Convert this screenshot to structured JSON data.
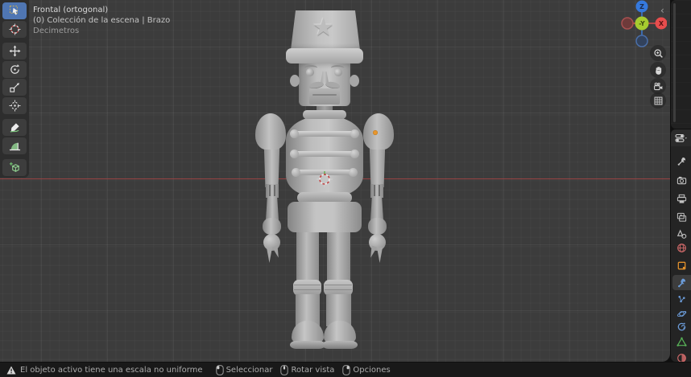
{
  "viewport_overlay": {
    "view_name": "Frontal (ortogonal)",
    "collection_path": "(0) Colección de la escena | Brazo",
    "units": "Decimetros"
  },
  "axis_gizmo": {
    "z_label": "Z",
    "x_label": "X",
    "center_label": "-Y",
    "x_color": "#e84d4d",
    "z_color": "#3579dd",
    "center_color": "#a6cc2f",
    "neg_x_color": "#6e3a3a",
    "neg_z_color": "#32425c"
  },
  "toolbar": {
    "tools": [
      {
        "icon": "select-box-icon",
        "active": true
      },
      {
        "icon": "cursor-icon",
        "active": false
      },
      {
        "icon": "move-icon",
        "active": false
      },
      {
        "icon": "rotate-icon",
        "active": false
      },
      {
        "icon": "scale-icon",
        "active": false
      },
      {
        "icon": "transform-icon",
        "active": false
      },
      {
        "icon": "annotate-icon",
        "active": false
      },
      {
        "icon": "measure-icon",
        "active": false
      },
      {
        "icon": "add-cube-icon",
        "active": false
      }
    ],
    "groups": [
      2,
      4,
      2,
      1
    ]
  },
  "nav_buttons": [
    {
      "icon": "zoom-icon"
    },
    {
      "icon": "pan-hand-icon"
    },
    {
      "icon": "camera-view-icon"
    },
    {
      "icon": "grid-ortho-icon"
    }
  ],
  "sidebar_toggle_glyph": "‹",
  "properties_editor": {
    "header_icon": "properties-editor-icon",
    "active_tab": "modifiers",
    "tabs": [
      {
        "name": "tool",
        "color": "#c2c2c2"
      },
      {
        "name": "render",
        "color": "#c2c2c2"
      },
      {
        "name": "output",
        "color": "#c2c2c2"
      },
      {
        "name": "view-layer",
        "color": "#c2c2c2"
      },
      {
        "name": "scene",
        "color": "#c2c2c2"
      },
      {
        "name": "world",
        "color": "#d16a6a"
      },
      {
        "name": "object",
        "color": "#e0902c"
      },
      {
        "name": "modifiers",
        "color": "#6b9bd8"
      },
      {
        "name": "particles",
        "color": "#6b9bd8"
      },
      {
        "name": "physics",
        "color": "#6b9bd8"
      },
      {
        "name": "constraints",
        "color": "#6b9bd8"
      },
      {
        "name": "data",
        "color": "#58b458"
      },
      {
        "name": "material",
        "color": "#d16a6a"
      }
    ]
  },
  "status_bar": {
    "warning": "El objeto activo tiene una escala no uniforme",
    "hints": [
      {
        "button": "left",
        "label": "Seleccionar"
      },
      {
        "button": "middle",
        "label": "Rotar vista"
      },
      {
        "button": "right",
        "label": "Opciones"
      }
    ]
  },
  "scene_markers": {
    "cursor_3d": "3d-cursor",
    "object_origin_color": "#e8972e"
  },
  "colors": {
    "viewport_bg": "#3c3c3c",
    "x_axis_line": "#9d4343",
    "accent_blue": "#4f76b3",
    "model_gray": "#b5b5b5"
  }
}
